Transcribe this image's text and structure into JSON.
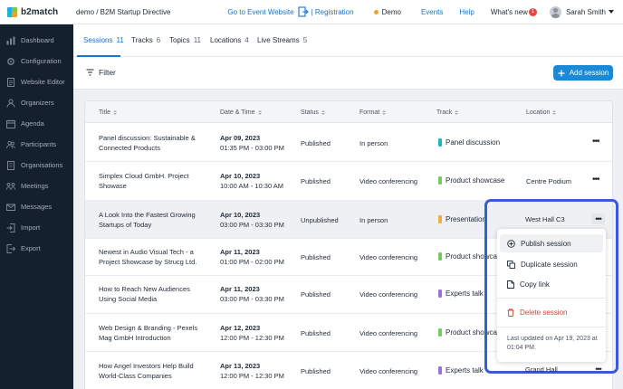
{
  "header": {
    "logo_text": "b2match",
    "breadcrumb": "demo / B2M Startup Directive",
    "go_to_event": "Go to Event Website",
    "registration": "| Registration",
    "demo": "Demo",
    "events": "Events",
    "help": "Help",
    "whats_new": "What's new",
    "whats_new_count": "1",
    "user_name": "Sarah Smith"
  },
  "sidebar": {
    "items": [
      {
        "label": "Dashboard",
        "icon": "dashboard-icon"
      },
      {
        "label": "Configuration",
        "icon": "gear-icon"
      },
      {
        "label": "Website Editor",
        "icon": "document-icon"
      },
      {
        "label": "Organizers",
        "icon": "people-icon"
      },
      {
        "label": "Agenda",
        "icon": "calendar-icon"
      },
      {
        "label": "Participants",
        "icon": "users-icon"
      },
      {
        "label": "Organisations",
        "icon": "building-icon"
      },
      {
        "label": "Meetings",
        "icon": "meetings-icon"
      },
      {
        "label": "Messages",
        "icon": "mail-icon"
      },
      {
        "label": "Import",
        "icon": "import-icon"
      },
      {
        "label": "Export",
        "icon": "export-icon"
      }
    ]
  },
  "tabs": [
    {
      "label": "Sessions",
      "count": "11"
    },
    {
      "label": "Tracks",
      "count": "6"
    },
    {
      "label": "Topics",
      "count": "11"
    },
    {
      "label": "Locations",
      "count": "4"
    },
    {
      "label": "Live Streams",
      "count": "5"
    }
  ],
  "toolbar": {
    "filter": "Filter",
    "add_session": "Add session"
  },
  "table": {
    "columns": [
      "Title",
      "Date & Time",
      "Status",
      "Format",
      "Track",
      "Location"
    ],
    "rows": [
      {
        "title": "Panel discussion: Sustainable & Connected Products",
        "date": "Apr 09, 2023",
        "time": "01:35 PM - 03:00 PM",
        "status": "Published",
        "format": "In person",
        "track": "Panel discussion",
        "track_color": "#1fb3c7",
        "location": ""
      },
      {
        "title": "Simplex Cloud GmbH. Project Showase",
        "date": "Apr 10, 2023",
        "time": "10:00 AM - 10:30 AM",
        "status": "Published",
        "format": "Video conferencing",
        "track": "Product showcase",
        "track_color": "#6fcf57",
        "location": "Centre Podium"
      },
      {
        "title": "A Look Into the Fastest Growing Startups of Today",
        "date": "Apr 10, 2023",
        "time": "03:00 PM - 03:30 PM",
        "status": "Unpublished",
        "format": "In person",
        "track": "Presentation",
        "track_color": "#f0a94a",
        "location": "West Hall C3"
      },
      {
        "title": "Newest in Audio Visual Tech - a Project Showcase by Strucg Ltd.",
        "date": "Apr 11, 2023",
        "time": "01:00 PM - 02:00 PM",
        "status": "Published",
        "format": "Video conferencing",
        "track": "Product showcase",
        "track_color": "#6fcf57",
        "location": ""
      },
      {
        "title": "How to Reach New Audiences Using Social Media",
        "date": "Apr 11, 2023",
        "time": "03:00 PM - 03:30 PM",
        "status": "Published",
        "format": "Video conferencing",
        "track": "Experts talk",
        "track_color": "#9b6fe0",
        "location": ""
      },
      {
        "title": "Web Design & Branding - Pexels Mag GmbH Introduction",
        "date": "Apr 12, 2023",
        "time": "12:00 PM - 12:30 PM",
        "status": "Published",
        "format": "Video conferencing",
        "track": "Product showcase",
        "track_color": "#6fcf57",
        "location": ""
      },
      {
        "title": "How Angel Investors Help Build World-Class Companies",
        "date": "Apr 13, 2023",
        "time": "12:00 PM - 12:30 PM",
        "status": "Published",
        "format": "Video conferencing",
        "track": "Experts talk",
        "track_color": "#9b6fe0",
        "location": "Grand Hall"
      }
    ]
  },
  "context_menu": {
    "publish": "Publish session",
    "duplicate": "Duplicate session",
    "copy_link": "Copy link",
    "delete": "Delete session",
    "last_updated": "Last updated on Apr 19, 2023 at 01:04 PM.",
    "danger_color": "#d6423b"
  },
  "colors": {
    "accent": "#1a73c8",
    "primary_button": "#1a8ad8",
    "sidebar_bg": "#15202f",
    "highlight_frame": "#3a5bd6"
  }
}
